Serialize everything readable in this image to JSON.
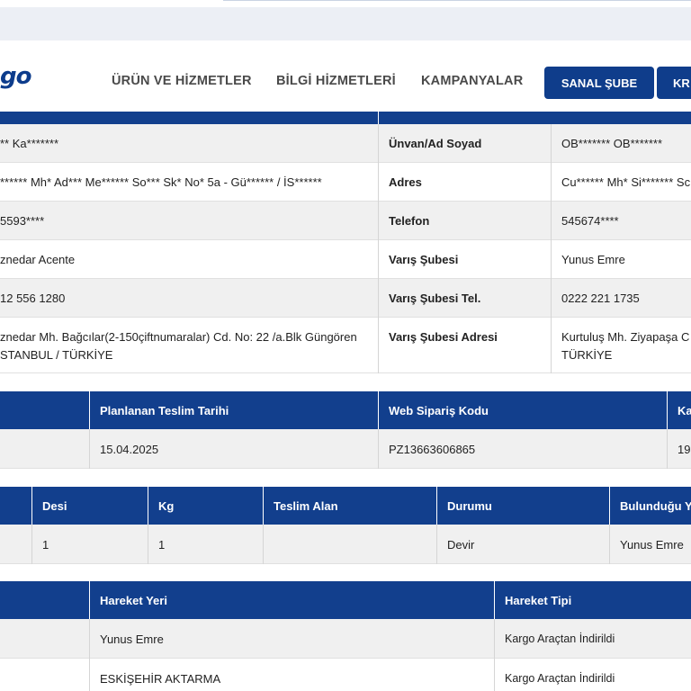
{
  "brand": {
    "logo_text": "go"
  },
  "nav": {
    "links": [
      "ÜRÜN VE HİZMETLER",
      "BİLGİ HİZMETLERİ",
      "KAMPANYALAR"
    ],
    "buttons": [
      "SANAL ŞUBE",
      "KR"
    ]
  },
  "sender_receiver": {
    "rows": [
      {
        "left_value": "** Ka*******",
        "right_label": "Ünvan/Ad Soyad",
        "right_value": "OB******* OB*******"
      },
      {
        "left_value": "****** Mh* Ad*** Me****** So*** Sk* No* 5a - Gü****** / İS******",
        "right_label": "Adres",
        "right_value": "Cu****** Mh* Si******* Sc"
      },
      {
        "left_value": "5593****",
        "right_label": "Telefon",
        "right_value": "545674****"
      },
      {
        "left_value": "znedar Acente",
        "right_label": "Varış Şubesi",
        "right_value": "Yunus Emre"
      },
      {
        "left_value": "12 556 1280",
        "right_label": "Varış Şubesi Tel.",
        "right_value": "0222 221 1735"
      },
      {
        "left_value_line1": "znedar Mh. Bağcılar(2-150çiftnumaralar) Cd. No: 22 /a.Blk Güngören",
        "left_value_line2": "STANBUL / TÜRKİYE",
        "right_label": "Varış Şubesi Adresi",
        "right_value_line1": "Kurtuluş Mh. Ziyapaşa C",
        "right_value_line2": "TÜRKİYE"
      }
    ]
  },
  "order_table": {
    "headers": [
      "Planlanan Teslim Tarihi",
      "Web Sipariş Kodu",
      "Ka"
    ],
    "row": [
      "15.04.2025",
      "PZ13663606865",
      "19"
    ]
  },
  "package_table": {
    "headers": [
      "Desi",
      "Kg",
      "Teslim Alan",
      "Durumu",
      "Bulunduğu Y"
    ],
    "row": [
      "1",
      "1",
      "",
      "Devir",
      "Yunus Emre"
    ]
  },
  "movement_table": {
    "headers": [
      "Hareket Yeri",
      "Hareket Tipi"
    ],
    "rows": [
      {
        "place": "Yunus Emre",
        "type": "Kargo Araçtan İndirildi"
      },
      {
        "place": "ESKİŞEHİR AKTARMA",
        "type": "Kargo Araçtan İndirildi"
      }
    ]
  },
  "colors": {
    "header_blue": "#123f8d",
    "button_blue": "#0f3d8b",
    "row_grey": "#f0f0f0"
  }
}
